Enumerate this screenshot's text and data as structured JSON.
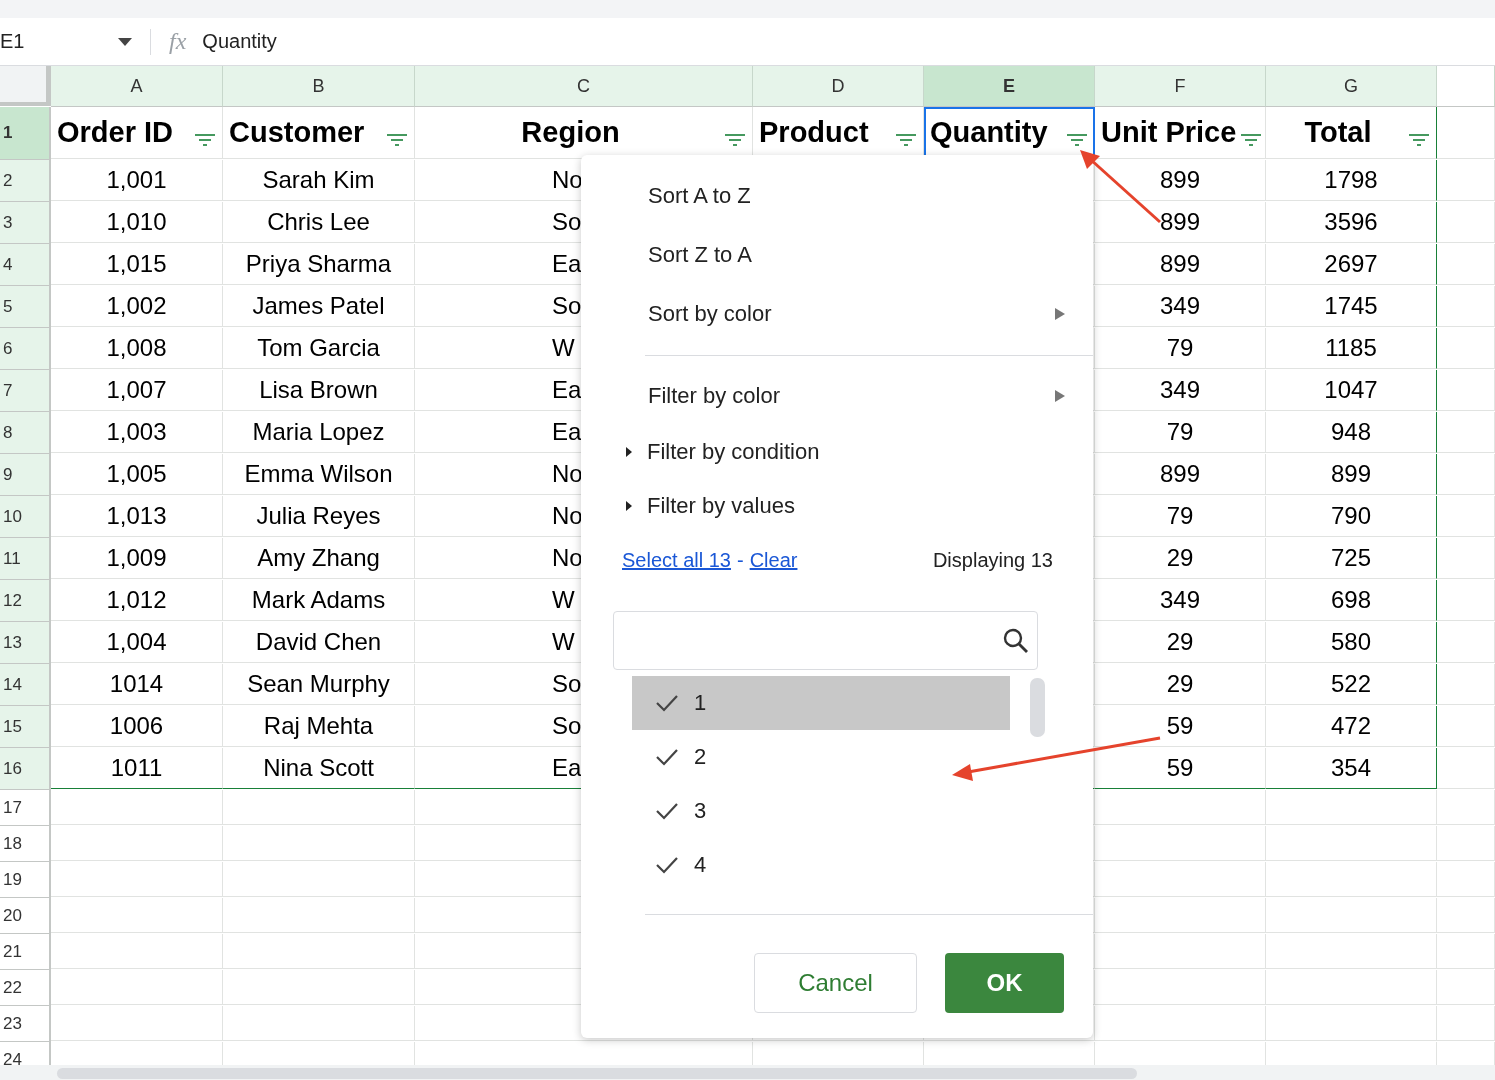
{
  "formula_bar": {
    "name_box": "E1",
    "fx": "fx",
    "formula": "Quantity"
  },
  "sheet": {
    "columns": [
      {
        "letter": "A",
        "selected": false,
        "filtered": true
      },
      {
        "letter": "B",
        "selected": false,
        "filtered": true
      },
      {
        "letter": "C",
        "selected": false,
        "filtered": true
      },
      {
        "letter": "D",
        "selected": false,
        "filtered": true
      },
      {
        "letter": "E",
        "selected": true,
        "filtered": true
      },
      {
        "letter": "F",
        "selected": false,
        "filtered": true
      },
      {
        "letter": "G",
        "selected": false,
        "filtered": true
      }
    ],
    "header": {
      "row": "1",
      "selected": true,
      "cells": [
        {
          "text": "Order ID",
          "filter": true
        },
        {
          "text": "Customer",
          "filter": true
        },
        {
          "text": "Region",
          "filter": true
        },
        {
          "text": "Product",
          "filter": true
        },
        {
          "text": "Quantity",
          "filter": true
        },
        {
          "text": "Unit Price",
          "filter": true
        },
        {
          "text": "Total",
          "filter": true
        }
      ]
    },
    "rows": [
      {
        "row": "2",
        "cells": {
          "A": "1,001",
          "B": "Sarah Kim",
          "C": "No",
          "F": "899",
          "G": "1798"
        }
      },
      {
        "row": "3",
        "cells": {
          "A": "1,010",
          "B": "Chris Lee",
          "C": "So",
          "F": "899",
          "G": "3596"
        }
      },
      {
        "row": "4",
        "cells": {
          "A": "1,015",
          "B": "Priya Sharma",
          "C": "Ea",
          "F": "899",
          "G": "2697"
        }
      },
      {
        "row": "5",
        "cells": {
          "A": "1,002",
          "B": "James Patel",
          "C": "So",
          "F": "349",
          "G": "1745"
        }
      },
      {
        "row": "6",
        "cells": {
          "A": "1,008",
          "B": "Tom Garcia",
          "C": "W",
          "F": "79",
          "G": "1185"
        }
      },
      {
        "row": "7",
        "cells": {
          "A": "1,007",
          "B": "Lisa Brown",
          "C": "Ea",
          "F": "349",
          "G": "1047"
        }
      },
      {
        "row": "8",
        "cells": {
          "A": "1,003",
          "B": "Maria Lopez",
          "C": "Ea",
          "F": "79",
          "G": "948"
        }
      },
      {
        "row": "9",
        "cells": {
          "A": "1,005",
          "B": "Emma Wilson",
          "C": "No",
          "F": "899",
          "G": "899"
        }
      },
      {
        "row": "10",
        "cells": {
          "A": "1,013",
          "B": "Julia Reyes",
          "C": "No",
          "F": "79",
          "G": "790"
        }
      },
      {
        "row": "11",
        "cells": {
          "A": "1,009",
          "B": "Amy Zhang",
          "C": "No",
          "F": "29",
          "G": "725"
        }
      },
      {
        "row": "12",
        "cells": {
          "A": "1,012",
          "B": "Mark Adams",
          "C": "W",
          "F": "349",
          "G": "698"
        }
      },
      {
        "row": "13",
        "cells": {
          "A": "1,004",
          "B": "David Chen",
          "C": "W",
          "F": "29",
          "G": "580"
        }
      },
      {
        "row": "14",
        "cells": {
          "A": "1014",
          "B": "Sean Murphy",
          "C": "So",
          "F": "29",
          "G": "522"
        }
      },
      {
        "row": "15",
        "cells": {
          "A": "1006",
          "B": "Raj Mehta",
          "C": "So",
          "F": "59",
          "G": "472"
        }
      },
      {
        "row": "16",
        "cells": {
          "A": "1011",
          "B": "Nina Scott",
          "C": "Ea",
          "F": "59",
          "G": "354"
        }
      }
    ],
    "empty_rows": [
      "17",
      "18",
      "19",
      "20",
      "21",
      "22",
      "23",
      "24"
    ]
  },
  "filter_menu": {
    "items": [
      {
        "kind": "plain",
        "label": "Sort A to Z"
      },
      {
        "kind": "plain",
        "label": "Sort Z to A"
      },
      {
        "kind": "submenu",
        "label": "Sort by color"
      },
      {
        "kind": "divider"
      },
      {
        "kind": "submenu",
        "label": "Filter by color"
      },
      {
        "kind": "section",
        "label": "Filter by condition",
        "expanded": false
      },
      {
        "kind": "section",
        "label": "Filter by values",
        "expanded": false
      }
    ],
    "select_all": "Select all 13",
    "separator": "-",
    "clear": "Clear",
    "count": "Displaying 13",
    "values": [
      {
        "label": "1",
        "checked": true,
        "selected": true
      },
      {
        "label": "2",
        "checked": true,
        "selected": false
      },
      {
        "label": "3",
        "checked": true,
        "selected": false
      },
      {
        "label": "4",
        "checked": true,
        "selected": false
      }
    ],
    "buttons": {
      "cancel": "Cancel",
      "ok": "OK"
    }
  }
}
